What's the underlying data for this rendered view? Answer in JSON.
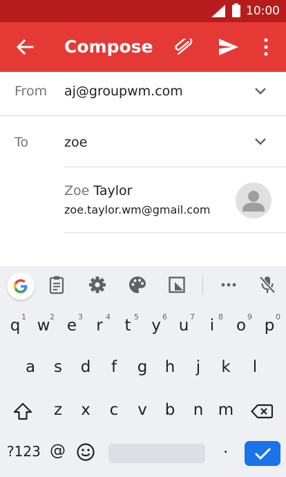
{
  "status_bar": {
    "time": "10:00"
  },
  "app_bar": {
    "title": "Compose"
  },
  "compose": {
    "from_label": "From",
    "from_value": "aj@groupwm.com",
    "to_label": "To",
    "to_value": "zoe"
  },
  "suggestion": {
    "name_match": "Zoe",
    "name_rest": " Taylor",
    "email": "zoe.taylor.wm@gmail.com"
  },
  "keyboard": {
    "row1": [
      {
        "k": "q",
        "hint": "1"
      },
      {
        "k": "w",
        "hint": "2"
      },
      {
        "k": "e",
        "hint": "3"
      },
      {
        "k": "r",
        "hint": "4"
      },
      {
        "k": "t",
        "hint": "5"
      },
      {
        "k": "y",
        "hint": "6"
      },
      {
        "k": "u",
        "hint": "7"
      },
      {
        "k": "i",
        "hint": "8"
      },
      {
        "k": "o",
        "hint": "9"
      },
      {
        "k": "p",
        "hint": "0"
      }
    ],
    "row2": [
      "a",
      "s",
      "d",
      "f",
      "g",
      "h",
      "j",
      "k",
      "l"
    ],
    "row3": [
      "z",
      "x",
      "c",
      "v",
      "b",
      "n",
      "m"
    ],
    "symbols_label": "?123",
    "at_label": "@",
    "period_label": "."
  },
  "colors": {
    "status_bar": "#b71c1c",
    "app_bar": "#e53935",
    "enter_key": "#1a73e8"
  },
  "icons": {
    "back": "arrow-left-icon",
    "attach": "paperclip-icon",
    "send": "send-icon",
    "more": "more-vert-icon",
    "google": "google-g-icon",
    "clipboard": "clipboard-icon",
    "settings": "gear-icon",
    "theme": "palette-icon",
    "screenshot": "crop-icon",
    "overflow": "more-horiz-icon",
    "mic_off": "mic-off-icon",
    "shift": "shift-icon",
    "backspace": "backspace-icon",
    "emoji": "emoji-icon",
    "enter": "check-icon"
  }
}
